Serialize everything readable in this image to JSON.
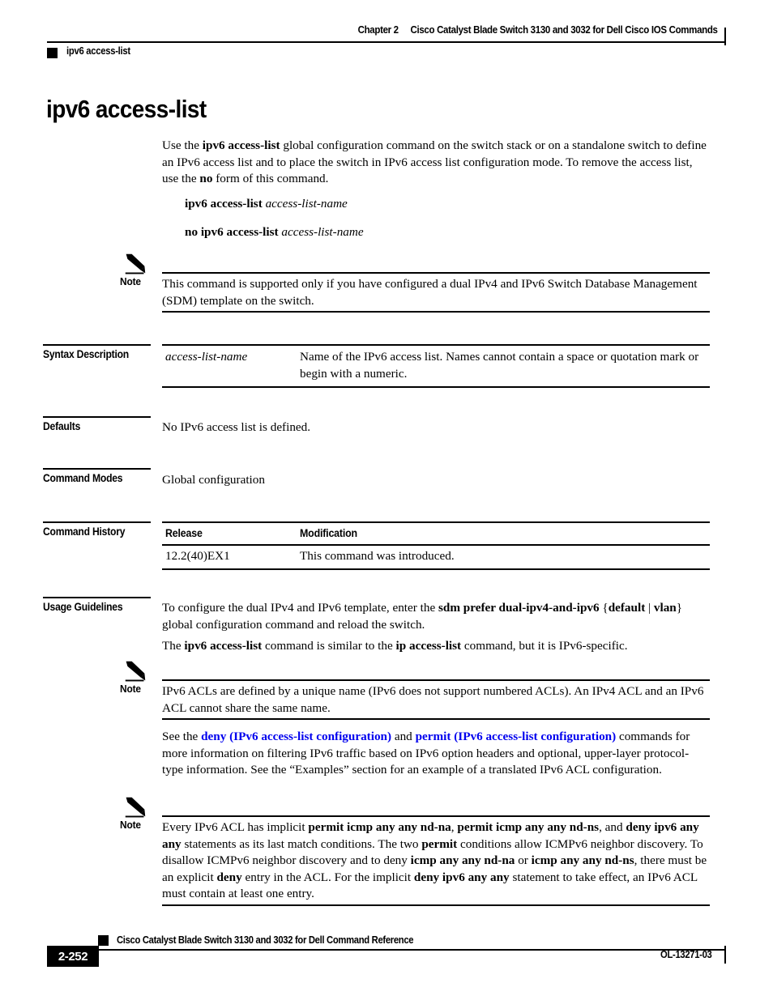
{
  "header": {
    "chapter": "Chapter 2",
    "book_title": "Cisco Catalyst Blade Switch 3130 and 3032 for Dell Cisco IOS Commands",
    "topic": "ipv6 access-list"
  },
  "title": "ipv6 access-list",
  "intro": {
    "p1_a": "Use the ",
    "p1_b1": "ipv6 access-list",
    "p1_c": " global configuration command on the switch stack or on a standalone switch to define an IPv6 access list and to place the switch in IPv6 access list configuration mode. To remove the access list, use the ",
    "p1_b2": "no",
    "p1_d": " form of this command."
  },
  "syntax": {
    "line1_bold": "ipv6 access-list",
    "line1_italic": "access-list-name",
    "line2_bold": "no ipv6 access-list",
    "line2_italic": "access-list-name"
  },
  "note1": {
    "label": "Note",
    "text": "This command is supported only if you have configured a dual IPv4 and IPv6 Switch Database Management (SDM) template on the switch."
  },
  "syntax_description": {
    "label": "Syntax Description",
    "rows": [
      {
        "term": "access-list-name",
        "desc": "Name of the IPv6 access list. Names cannot contain a space or quotation mark or begin with a numeric."
      }
    ]
  },
  "defaults": {
    "label": "Defaults",
    "text": "No IPv6 access list is defined."
  },
  "command_modes": {
    "label": "Command Modes",
    "text": "Global configuration"
  },
  "command_history": {
    "label": "Command History",
    "columns": [
      "Release",
      "Modification"
    ],
    "rows": [
      {
        "release": "12.2(40)EX1",
        "modification": "This command was introduced."
      }
    ]
  },
  "usage_guidelines": {
    "label": "Usage Guidelines",
    "p1_a": "To configure the dual IPv4 and IPv6 template, enter the ",
    "p1_b": "sdm prefer dual-ipv4-and-ipv6",
    "p1_c": " {",
    "p1_b2": "default",
    "p1_d": " | ",
    "p1_b3": "vlan",
    "p1_e": "} global configuration command and reload the switch.",
    "p2_a": "The ",
    "p2_b1": "ipv6 access-list",
    "p2_c": " command is similar to the ",
    "p2_b2": "ip access-list",
    "p2_d": " command, but it is IPv6-specific."
  },
  "note2": {
    "label": "Note",
    "text": "IPv6 ACLs are defined by a unique name (IPv6 does not support numbered ACLs). An IPv4 ACL and an IPv6 ACL cannot share the same name."
  },
  "see_also": {
    "a": "See the ",
    "link1": "deny (IPv6 access-list configuration)",
    "b": " and ",
    "link2": "permit (IPv6 access-list configuration)",
    "c": " commands for more information on filtering IPv6 traffic based on IPv6 option headers and optional, upper-layer protocol-type information. See the “Examples” section for an example of a translated IPv6 ACL configuration."
  },
  "note3": {
    "label": "Note",
    "a": "Every IPv6 ACL has implicit ",
    "b1": "permit icmp any any nd-na",
    "c": ", ",
    "b2": "permit icmp any any nd-ns",
    "d": ", and ",
    "b3": "deny ipv6 any any",
    "e": " statements as its last match conditions. The two ",
    "b4": "permit",
    "f": " conditions allow ICMPv6 neighbor discovery. To disallow ICMPv6 neighbor discovery and to deny ",
    "b5": "icmp any any nd-na",
    "g": " or ",
    "b6": "icmp any any nd-ns",
    "h": ", there must be an explicit ",
    "b7": "deny",
    "i": " entry in the ACL. For the implicit ",
    "b8": "deny ipv6 any any",
    "j": " statement to take effect, an IPv6 ACL must contain at least one entry."
  },
  "footer": {
    "book_title": "Cisco Catalyst Blade Switch 3130 and 3032 for Dell Command Reference",
    "page_number": "2-252",
    "doc_id": "OL-13271-03"
  },
  "colors": {
    "link": "#0000EE",
    "rule": "#000000",
    "text": "#000000"
  }
}
